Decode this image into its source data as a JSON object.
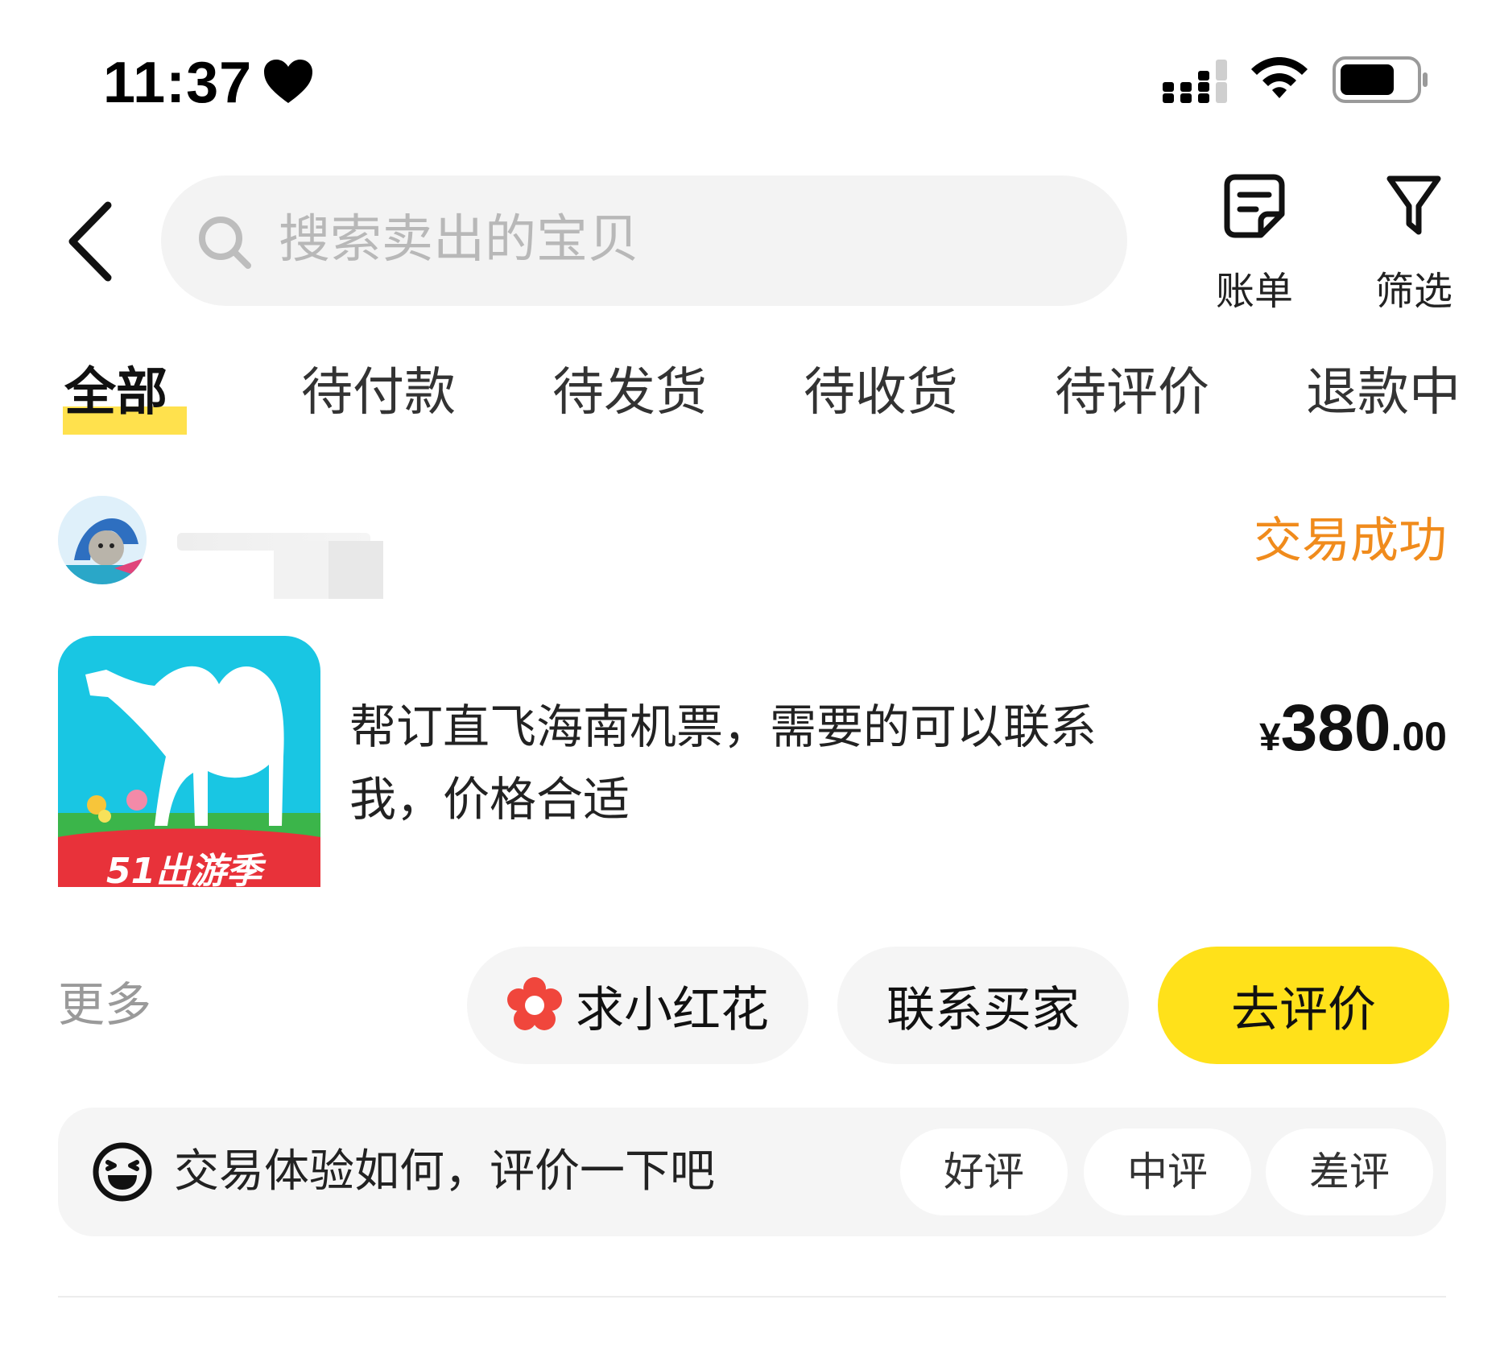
{
  "status_bar": {
    "time": "11:37"
  },
  "search": {
    "placeholder": "搜索卖出的宝贝"
  },
  "toolbar": {
    "bill_label": "账单",
    "filter_label": "筛选"
  },
  "tabs": [
    {
      "label": "全部",
      "active": true
    },
    {
      "label": "待付款",
      "active": false
    },
    {
      "label": "待发货",
      "active": false
    },
    {
      "label": "待收货",
      "active": false
    },
    {
      "label": "待评价",
      "active": false
    },
    {
      "label": "退款中",
      "active": false
    }
  ],
  "order": {
    "status": "交易成功",
    "product_title": "帮订直飞海南机票，需要的可以联系我，价格合适",
    "product_image_text": "51出游季",
    "price_symbol": "¥",
    "price_integer": "380",
    "price_decimal": ".00",
    "more_label": "更多",
    "actions": {
      "ask_flower": "求小红花",
      "contact_buyer": "联系买家",
      "go_review": "去评价"
    },
    "review": {
      "prompt": "交易体验如何，评价一下吧",
      "good": "好评",
      "neutral": "中评",
      "bad": "差评"
    }
  },
  "colors": {
    "accent_yellow": "#ffe11a",
    "status_orange": "#f08b1c",
    "tab_highlight": "#ffe14d",
    "flower_red": "#f0463c"
  }
}
